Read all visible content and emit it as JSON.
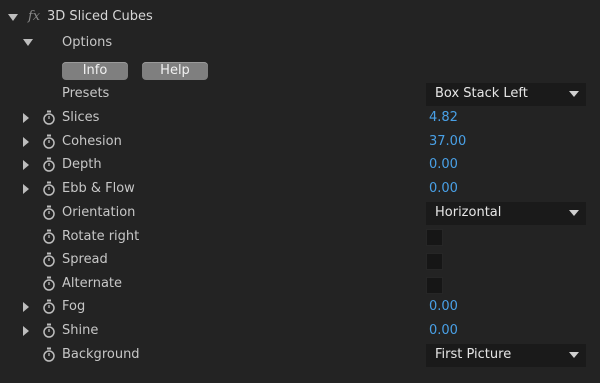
{
  "effect": {
    "fx_symbol": "fx",
    "title": "3D Sliced Cubes"
  },
  "options": {
    "label": "Options",
    "info_button": "Info",
    "help_button": "Help"
  },
  "presets": {
    "label": "Presets",
    "value": "Box Stack Left"
  },
  "properties": [
    {
      "label": "Slices",
      "value": "4.82"
    },
    {
      "label": "Cohesion",
      "value": "37.00"
    },
    {
      "label": "Depth",
      "value": "0.00"
    },
    {
      "label": "Ebb & Flow",
      "value": "0.00"
    },
    {
      "label": "Orientation",
      "value": "Horizontal"
    },
    {
      "label": "Rotate right",
      "value": ""
    },
    {
      "label": "Spread",
      "value": ""
    },
    {
      "label": "Alternate",
      "value": ""
    },
    {
      "label": "Fog",
      "value": "0.00"
    },
    {
      "label": "Shine",
      "value": "0.00"
    },
    {
      "label": "Background",
      "value": "First Picture"
    }
  ],
  "colors": {
    "background": "#232323",
    "value_blue": "#49a0e6",
    "dropdown_bg": "#1a1a1a",
    "button_bg": "#7f7f7f"
  }
}
